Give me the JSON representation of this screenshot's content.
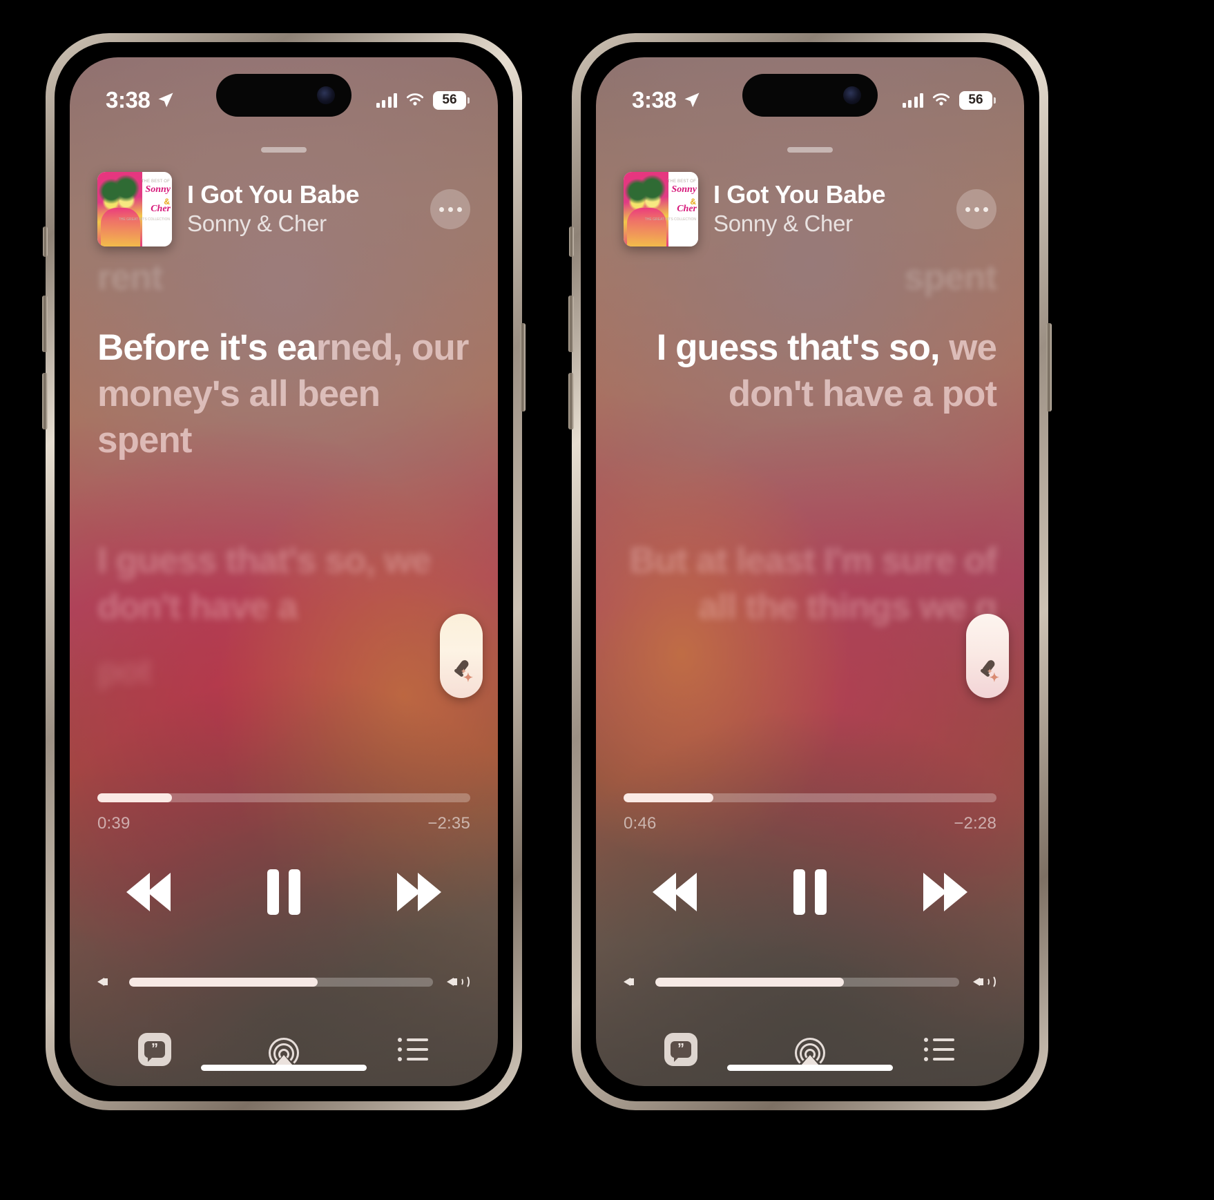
{
  "screens": [
    {
      "id": "left",
      "status": {
        "time": "3:38",
        "location_icon": "location-arrow-icon",
        "cellular_icon": "signal-bars-icon",
        "wifi_icon": "wifi-icon",
        "battery_percent": "56"
      },
      "now_playing": {
        "title": "I Got You Babe",
        "artist": "Sonny & Cher",
        "artwork_alt": "THE BEST OF Sonny & Cher THE GREAT HITS COLLECTION",
        "artwork_lines": {
          "top": "THE BEST OF",
          "name1": "Sonny",
          "amp": "&",
          "name2": "Cher",
          "bottom": "THE GREAT HITS COLLECTION"
        },
        "more_button_icon": "ellipsis-icon"
      },
      "lyrics": {
        "alignment": "left",
        "previous": "rent",
        "current_sung": "Before it's ea",
        "current_unsung": "rned, our money's all been spent",
        "next": "I guess that's so, we don't have a",
        "next2": "pot"
      },
      "sing_button": {
        "icon": "microphone-sparkle-icon",
        "label": "Sing"
      },
      "playback": {
        "elapsed": "0:39",
        "remaining": "−2:35",
        "progress_percent": 20,
        "rewind_icon": "rewind-icon",
        "play_pause_icon": "pause-icon",
        "forward_icon": "fast-forward-icon"
      },
      "volume": {
        "percent": 62,
        "min_icon": "speaker-low-icon",
        "max_icon": "speaker-high-icon"
      },
      "tabbar": [
        {
          "name": "lyrics",
          "icon": "lyrics-quote-icon",
          "active": true
        },
        {
          "name": "airplay",
          "icon": "airplay-icon",
          "active": false
        },
        {
          "name": "queue",
          "icon": "queue-list-icon",
          "active": false
        }
      ]
    },
    {
      "id": "right",
      "status": {
        "time": "3:38",
        "location_icon": "location-arrow-icon",
        "cellular_icon": "signal-bars-icon",
        "wifi_icon": "wifi-icon",
        "battery_percent": "56"
      },
      "now_playing": {
        "title": "I Got You Babe",
        "artist": "Sonny & Cher",
        "artwork_alt": "THE BEST OF Sonny & Cher THE GREAT HITS COLLECTION",
        "artwork_lines": {
          "top": "THE BEST OF",
          "name1": "Sonny",
          "amp": "&",
          "name2": "Cher",
          "bottom": "THE GREAT HITS COLLECTION"
        },
        "more_button_icon": "ellipsis-icon"
      },
      "lyrics": {
        "alignment": "right",
        "previous": "spent",
        "current_sung": "I guess that's so,",
        "current_unsung": " we don't have a pot",
        "next": "But at least I'm sure of all the things we g",
        "next2": ""
      },
      "sing_button": {
        "icon": "microphone-sparkle-icon",
        "label": "Sing"
      },
      "playback": {
        "elapsed": "0:46",
        "remaining": "−2:28",
        "progress_percent": 24,
        "rewind_icon": "rewind-icon",
        "play_pause_icon": "pause-icon",
        "forward_icon": "fast-forward-icon"
      },
      "volume": {
        "percent": 62,
        "min_icon": "speaker-low-icon",
        "max_icon": "speaker-high-icon"
      },
      "tabbar": [
        {
          "name": "lyrics",
          "icon": "lyrics-quote-icon",
          "active": true
        },
        {
          "name": "airplay",
          "icon": "airplay-icon",
          "active": false
        },
        {
          "name": "queue",
          "icon": "queue-list-icon",
          "active": false
        }
      ]
    }
  ],
  "colors": {
    "accent_cream": "#fbf0da",
    "lyric_active": "#ffffff",
    "lyric_inactive": "rgba(255,232,232,0.62)",
    "background_warm": "#a8475c"
  }
}
